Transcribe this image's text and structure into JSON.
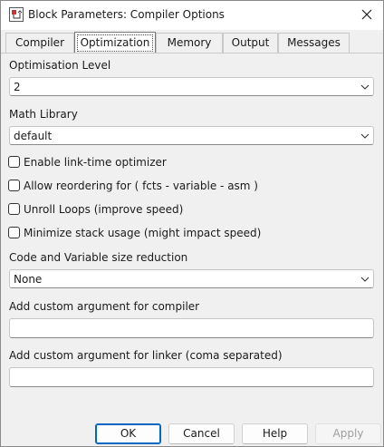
{
  "window": {
    "title": "Block Parameters: Compiler Options"
  },
  "tabs": [
    {
      "label": "Compiler",
      "active": false
    },
    {
      "label": "Optimization",
      "active": true
    },
    {
      "label": "Memory",
      "active": false
    },
    {
      "label": "Output",
      "active": false
    },
    {
      "label": "Messages",
      "active": false
    }
  ],
  "optimisation_level": {
    "label": "Optimisation Level",
    "value": "2"
  },
  "math_library": {
    "label": "Math Library",
    "value": "default"
  },
  "checkboxes": [
    {
      "label": "Enable link-time optimizer",
      "checked": false
    },
    {
      "label": "Allow reordering for ( fcts - variable - asm )",
      "checked": false
    },
    {
      "label": "Unroll Loops (improve speed)",
      "checked": false
    },
    {
      "label": "Minimize stack usage (might impact speed)",
      "checked": false
    }
  ],
  "size_reduction": {
    "label": "Code and Variable size reduction",
    "value": "None"
  },
  "compiler_args": {
    "label": "Add custom argument for compiler",
    "value": ""
  },
  "linker_args": {
    "label": "Add custom argument for linker (coma separated)",
    "value": ""
  },
  "buttons": {
    "ok": "OK",
    "cancel": "Cancel",
    "help": "Help",
    "apply": "Apply"
  },
  "colors": {
    "accent": "#0067c0",
    "background": "#f0f0f0"
  }
}
